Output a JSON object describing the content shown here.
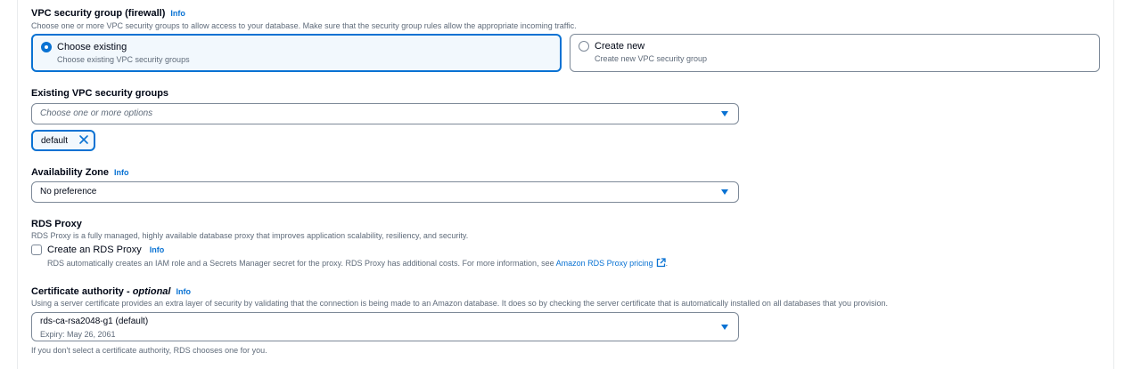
{
  "vpc_sg": {
    "label": "VPC security group (firewall)",
    "info": "Info",
    "description": "Choose one or more VPC security groups to allow access to your database. Make sure that the security group rules allow the appropriate incoming traffic.",
    "options": [
      {
        "title": "Choose existing",
        "desc": "Choose existing VPC security groups",
        "selected": true
      },
      {
        "title": "Create new",
        "desc": "Create new VPC security group",
        "selected": false
      }
    ]
  },
  "existing_sg": {
    "label": "Existing VPC security groups",
    "placeholder": "Choose one or more options",
    "tokens": [
      "default"
    ]
  },
  "az": {
    "label": "Availability Zone",
    "info": "Info",
    "value": "No preference"
  },
  "proxy": {
    "label": "RDS Proxy",
    "description": "RDS Proxy is a fully managed, highly available database proxy that improves application scalability, resiliency, and security.",
    "checkbox_label": "Create an RDS Proxy",
    "info": "Info",
    "checked": false,
    "help_text": "RDS automatically creates an IAM role and a Secrets Manager secret for the proxy. RDS Proxy has additional costs. For more information, see",
    "help_link": "Amazon RDS Proxy pricing",
    "help_link_icon": "external-link-icon",
    "help_suffix": "."
  },
  "cert": {
    "label": "Certificate authority -",
    "label_optional": "optional",
    "info": "Info",
    "description": "Using a server certificate provides an extra layer of security by validating that the connection is being made to an Amazon database. It does so by checking the server certificate that is automatically installed on all databases that you provision.",
    "value": "rds-ca-rsa2048-g1 (default)",
    "expiry": "Expiry: May 26, 2061",
    "footer": "If you don't select a certificate authority, RDS chooses one for you."
  },
  "colors": {
    "accent": "#0972d3",
    "text": "#000716",
    "muted": "#5f6b7a",
    "border": "#7d8998"
  }
}
